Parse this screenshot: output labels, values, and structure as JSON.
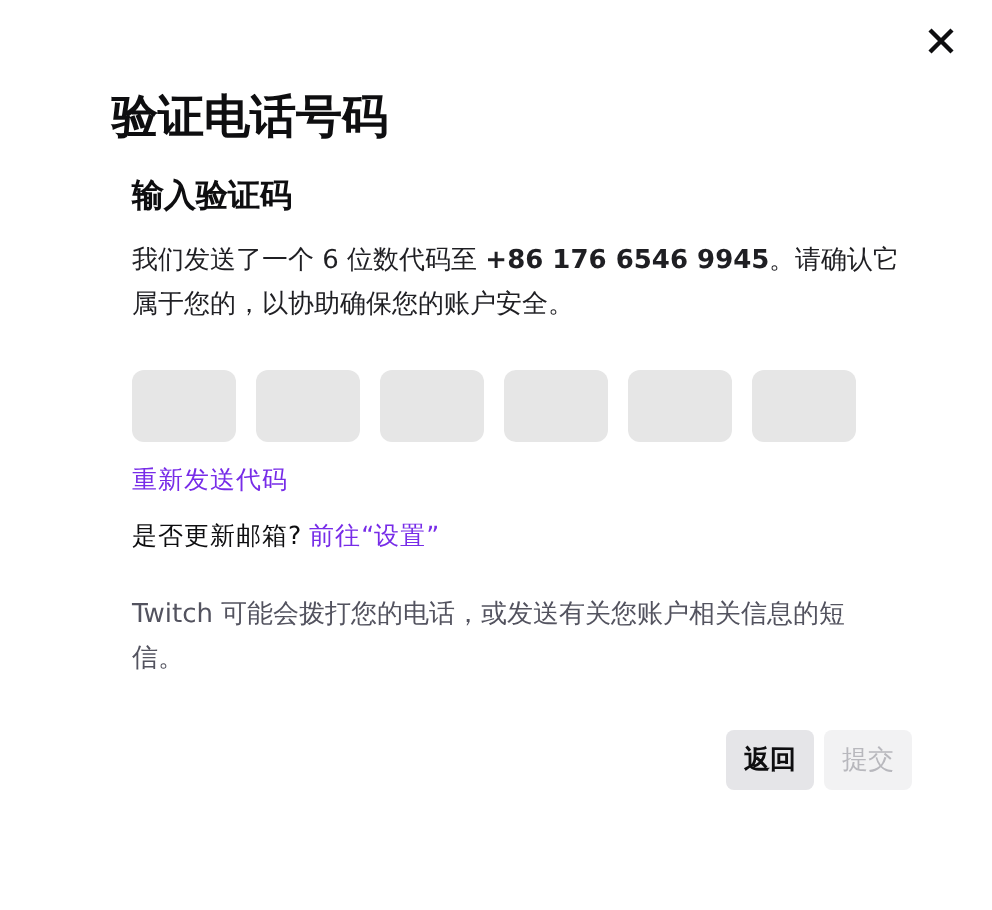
{
  "dialog": {
    "title": "验证电话号码",
    "subtitle": "输入验证码",
    "description": "我们发送了一个 6 位数代码至 **+86 176 6546 9945**。请确认它属于您的，以协助确保您的账户安全。",
    "code_fields": [
      {
        "filled": false
      },
      {
        "filled": false
      },
      {
        "filled": false
      },
      {
        "filled": false
      },
      {
        "filled": false
      },
      {
        "filled": false
      }
    ],
    "resend_link": "重新发送代码",
    "email_question": "是否更新邮箱?",
    "settings_link": "前往“设置”",
    "notice": "Twitch 可能会拨打您的电话，或发送有关您账户相关信息的短信。",
    "buttons": [
      {
        "label": "返回",
        "disabled": false
      },
      {
        "label": "提交",
        "disabled": true
      }
    ]
  }
}
